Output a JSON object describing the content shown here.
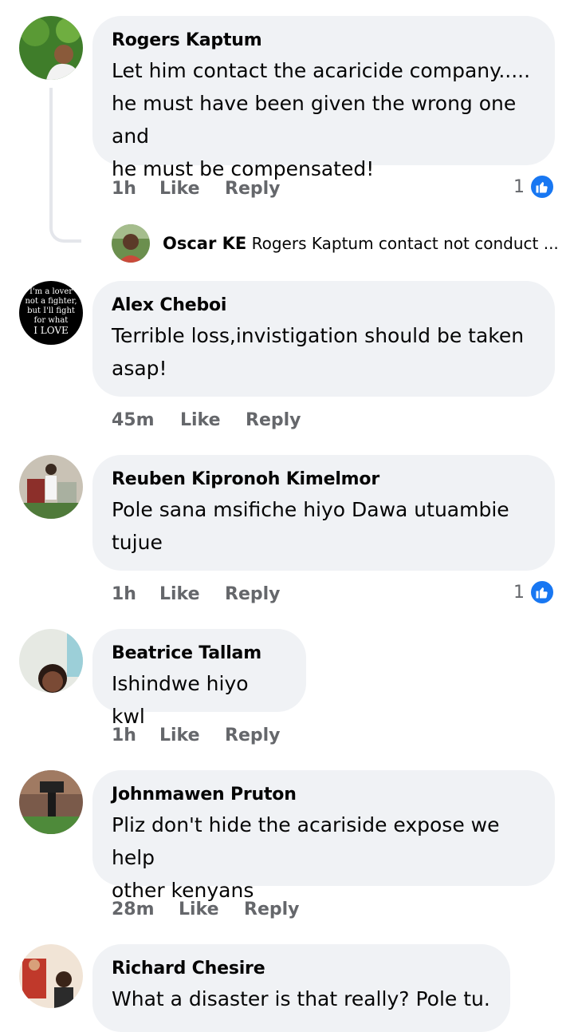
{
  "comments": [
    {
      "name": "Rogers Kaptum",
      "text": "Let him contact the acaricide company.....\nhe must have been given the wrong one and\nhe must be compensated!",
      "time": "1h",
      "like": "Like",
      "reply": "Reply",
      "reactions": "1"
    },
    {
      "name": "Alex Cheboi",
      "text": "Terrible loss,invistigation should be taken\nasap!",
      "time": "45m",
      "like": "Like",
      "reply": "Reply"
    },
    {
      "name": "Reuben Kipronoh Kimelmor",
      "text": "Pole sana msifiche hiyo Dawa utuambie\ntujue",
      "time": "1h",
      "like": "Like",
      "reply": "Reply",
      "reactions": "1"
    },
    {
      "name": "Beatrice Tallam",
      "text": "Ishindwe hiyo kwl",
      "time": "1h",
      "like": "Like",
      "reply": "Reply"
    },
    {
      "name": "Johnmawen Pruton",
      "text": "Pliz don't hide the acariside expose we help\nother kenyans",
      "time": "28m",
      "like": "Like",
      "reply": "Reply"
    },
    {
      "name": "Richard Chesire",
      "text": "What a disaster is that really? Pole tu."
    }
  ],
  "reply_preview": {
    "name": "Oscar KE",
    "text": "Rogers Kaptum contact not conduct ..."
  },
  "avatar_texts": {
    "alex": [
      "I'm a lover",
      "not a fighter,",
      "but I'll fight",
      "for what",
      "I LOVE"
    ]
  },
  "colors": {
    "bubble": "#f0f2f5",
    "meta": "#65676b",
    "like_blue": "#1877f2"
  }
}
